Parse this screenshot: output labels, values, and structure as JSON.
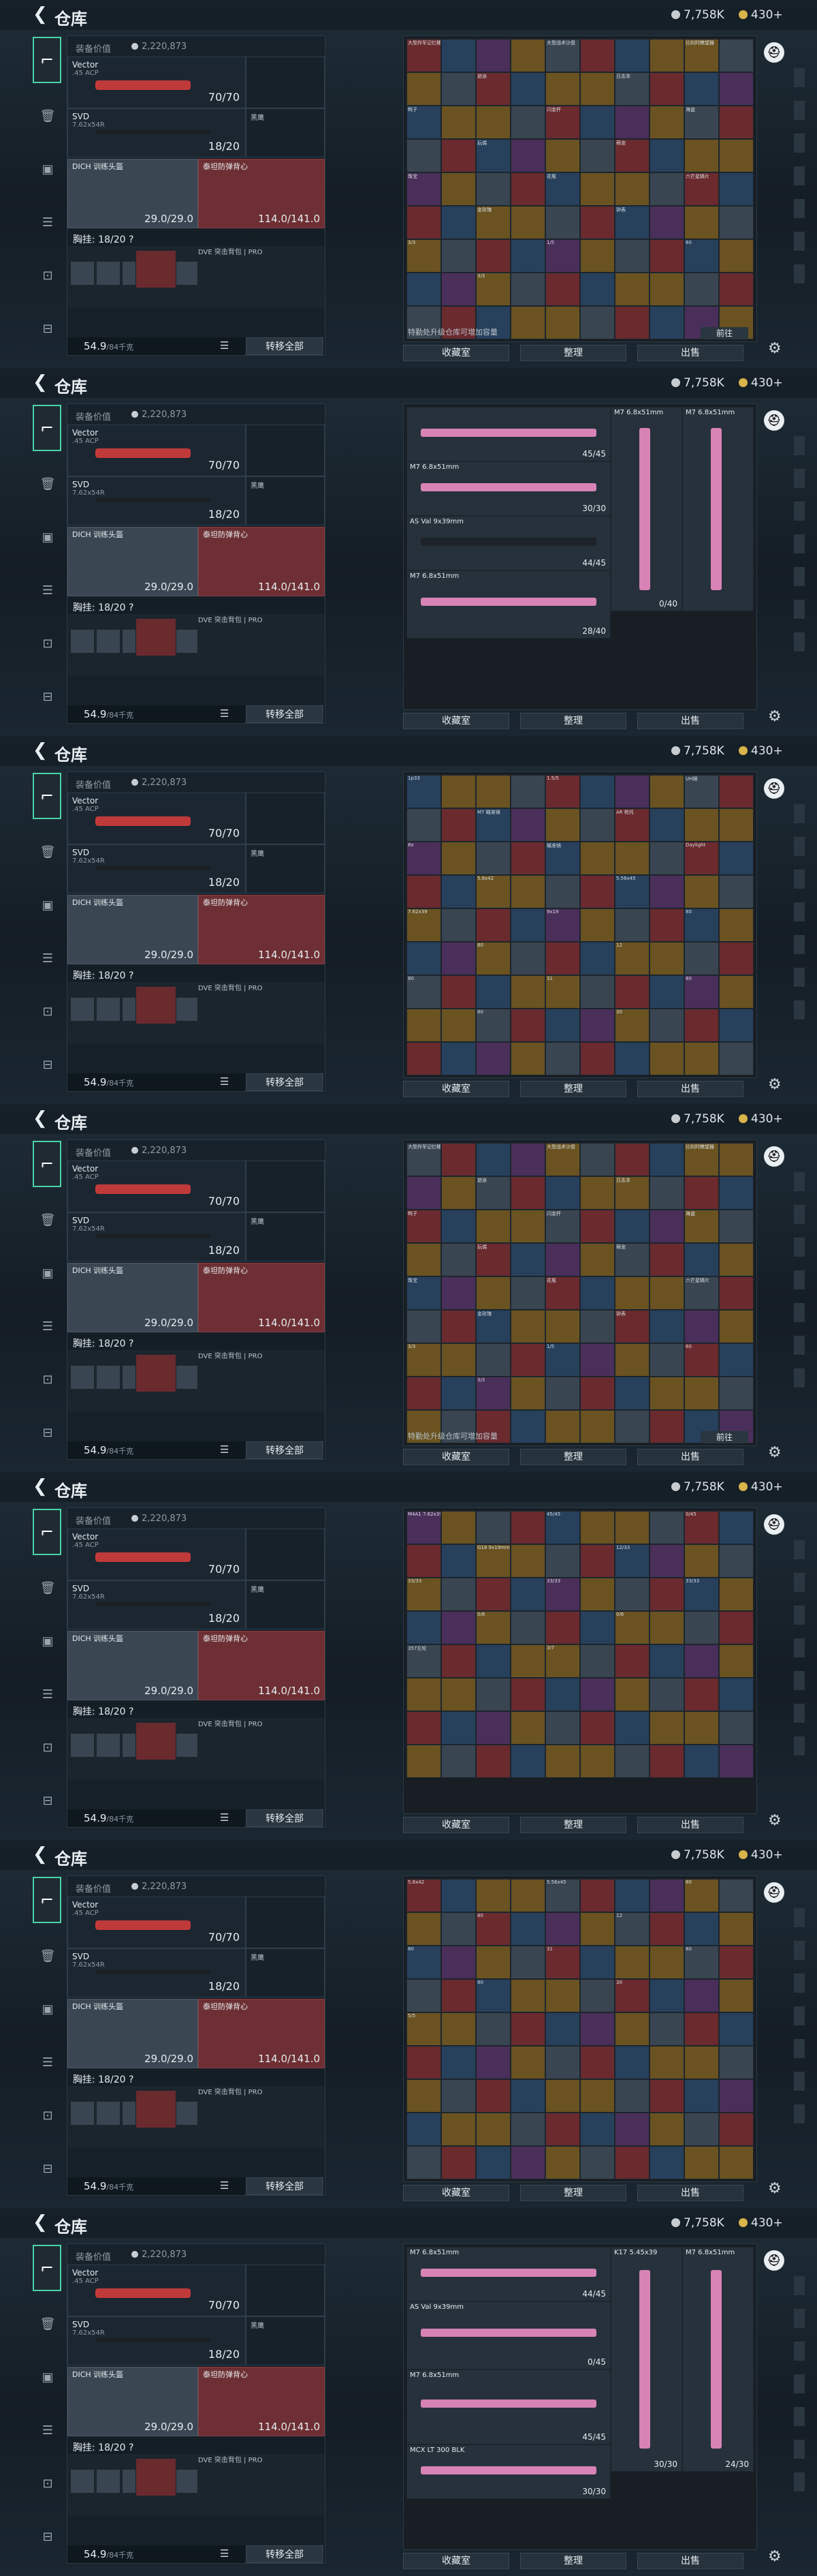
{
  "app": {
    "title": "仓库",
    "back_icon": "back-arrow-icon",
    "currency_silver": "7,758K",
    "currency_gold": "430+",
    "accent": "#4ad3a8"
  },
  "loadout": {
    "value_label": "装备价值",
    "value": "2,220,873",
    "primary": {
      "name": "Vector",
      "sub": ".45 ACP",
      "count": "70/70"
    },
    "secondary": {
      "name": "SVD",
      "sub": "7.62x54R",
      "count": "18/20",
      "side_label": "黑鹰"
    },
    "helmet": {
      "name": "DICH 训练头盔",
      "sub": "",
      "durability": "29.0/29.0"
    },
    "vest": {
      "name": "泰坦防弹背心",
      "sub": "安德兰卡",
      "durability": "114.0/141.0"
    },
    "chest_label": "胸挂: 18/20 ?",
    "chest_side": "DVE 突击背包 | PRO",
    "weight": "54.9",
    "weight_unit": "/84千克",
    "move_all": "转移全部"
  },
  "storage": {
    "note": "特勤处升级仓库可增加容量",
    "go": "前往",
    "buttons": [
      "收藏室",
      "整理",
      "出售"
    ]
  },
  "panels": [
    {
      "variant": "collectibles",
      "labels": [
        "大型炸军记忆桶",
        "大型战术沙盘",
        "比利时瞭望器",
        "旅途",
        "日志本",
        "鸭子",
        "闪金杯",
        "海盗",
        "玩偶",
        "萌宠",
        "珠宝",
        "花瓶",
        "六芒星鳞片",
        "金玫瑰",
        "钟表",
        "3/3",
        "1/5",
        "60",
        "3/3"
      ]
    },
    {
      "variant": "guns-pink",
      "guns": [
        {
          "name": "",
          "count": "45/45"
        },
        {
          "name": "M7 6.8x51mm",
          "count": "30/30"
        },
        {
          "name": "AS Val 9x39mm",
          "count": "44/45"
        },
        {
          "name": "M7 6.8x51mm",
          "count": "28/40"
        },
        {
          "name": "M7 6.8x51mm",
          "count": "0/40"
        },
        {
          "name": "M7 6.8x51mm",
          "count": ""
        }
      ]
    },
    {
      "variant": "attachments",
      "labels": [
        "1p33",
        "1.5/5",
        "UH镜",
        "M7 瞄准镜",
        "AR 枪托",
        "8x",
        "瞄准镜",
        "Daylight",
        "5.8x42",
        "5.56x45",
        "7.62x39",
        "9x19",
        "80",
        "80",
        "12",
        "80",
        "31",
        "80",
        "80",
        "30"
      ]
    },
    {
      "variant": "collectibles",
      "labels": [
        "大型炸军记忆桶",
        "大型战术沙盘",
        "比利时瞭望器",
        "旅途",
        "日志本",
        "鸭子",
        "闪金杯",
        "海盗",
        "玩偶",
        "萌宠",
        "珠宝",
        "花瓶",
        "六芒星鳞片",
        "金玫瑰",
        "钟表",
        "3/3",
        "1/5",
        "60",
        "3/3"
      ]
    },
    {
      "variant": "ammo",
      "labels": [
        "M4A1 7.62x39mm",
        "45/45",
        "0/45",
        "G18 9x19mm",
        "12/33",
        "33/33",
        "33/33",
        "33/33",
        "0/8",
        "0/6",
        "357左轮",
        "3/7"
      ]
    },
    {
      "variant": "cards",
      "labels": [
        "5.8x42",
        "5.56x45",
        "80",
        "80",
        "12",
        "80",
        "31",
        "80",
        "80",
        "30",
        "5/5"
      ]
    },
    {
      "variant": "guns-pink2",
      "guns": [
        {
          "name": "M7 6.8x51mm",
          "count": "44/45"
        },
        {
          "name": "AS Val 9x39mm",
          "count": "0/45"
        },
        {
          "name": "M7 6.8x51mm",
          "count": "45/45"
        },
        {
          "name": "MCX LT 300 BLK",
          "count": "30/30"
        },
        {
          "name": "K17 5.45x39",
          "count": "30/30"
        },
        {
          "name": "M7 6.8x51mm",
          "count": "24/30"
        }
      ]
    }
  ]
}
